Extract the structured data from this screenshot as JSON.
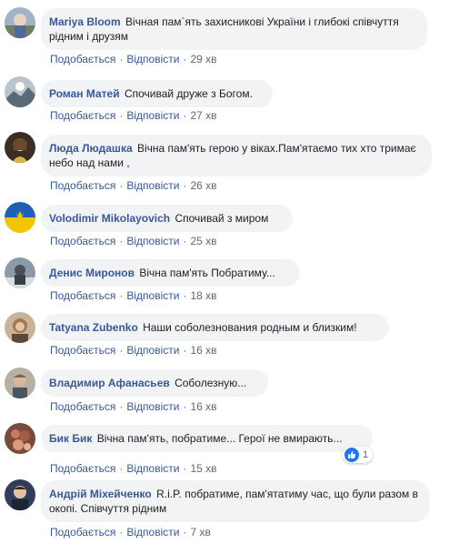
{
  "labels": {
    "like": "Подобається",
    "reply": "Відповісти",
    "sep": "·"
  },
  "comments": [
    {
      "author": "Mariya Bloom",
      "text": "Вічная пам`ять захисникові України і глибокі співчуття рідним і друзям",
      "time": "29 хв"
    },
    {
      "author": "Роман Матей",
      "text": "Спочивай друже з Богом.",
      "time": "27 хв"
    },
    {
      "author": "Люда Людашка",
      "text": "Вічна пам'ять герою у віках.Пам'ятаємо тих хто тримає небо над нами ,",
      "time": "26 хв"
    },
    {
      "author": "Volodimir Mikolayovich",
      "text": "Спочивай з миром",
      "time": "25 хв"
    },
    {
      "author": "Денис Миронов",
      "text": "Вічна пам'ять Побратиму...",
      "time": "18 хв"
    },
    {
      "author": "Tatyana Zubenko",
      "text": "Наши соболезнования родным и близким!",
      "time": "16 хв"
    },
    {
      "author": "Владимир Афанасьев",
      "text": "Соболезную...",
      "time": "16 хв"
    },
    {
      "author": "Бик Бик",
      "text": "Вічна пам'ять, побратиме... Герої не вмирають...",
      "time": "15 хв",
      "reaction_count": "1"
    },
    {
      "author": "Андрій Міхейченко",
      "text": "R.i.P. побратиме, пам'ятатиму час, що були разом в окопі. Співчуття рідним",
      "time": "7 хв"
    }
  ],
  "colors": {
    "link": "#385898",
    "bubble": "#f2f3f5",
    "meta": "#606770",
    "like_blue": "#1877f2"
  }
}
